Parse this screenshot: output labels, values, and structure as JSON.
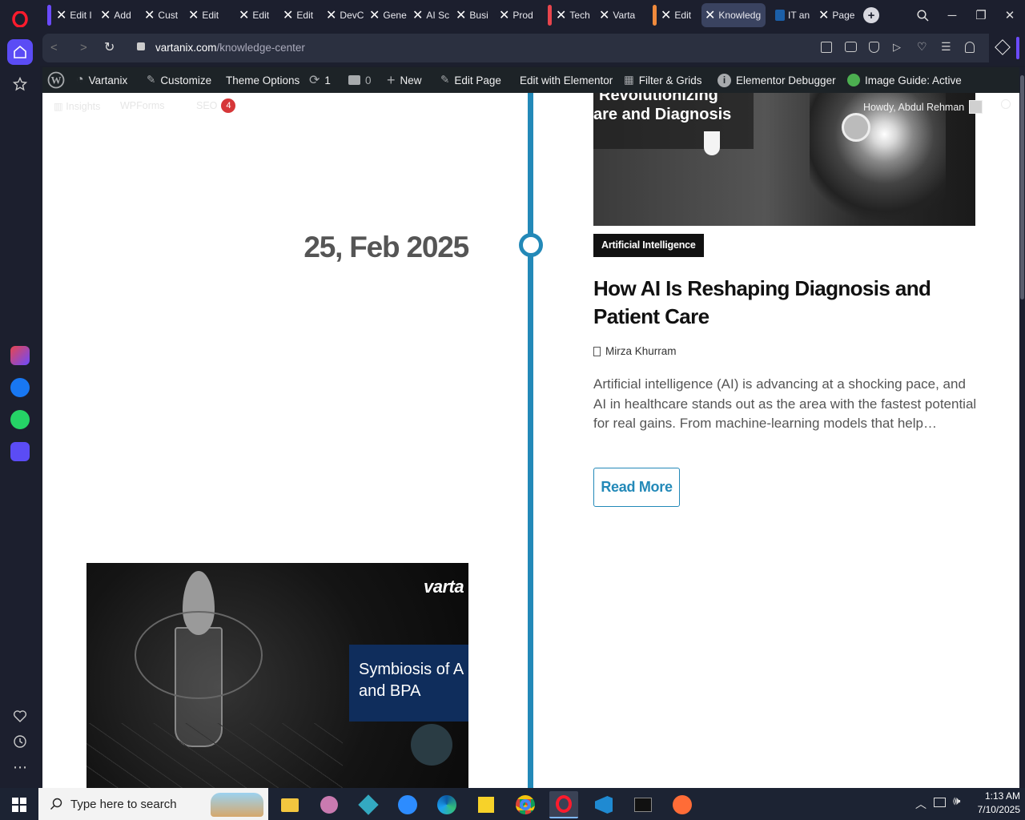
{
  "browser": {
    "tabs": [
      {
        "label": "Edit I"
      },
      {
        "label": "Add"
      },
      {
        "label": "Cust"
      },
      {
        "label": "Edit "
      },
      {
        "label": "Edit "
      },
      {
        "label": "Edit "
      },
      {
        "label": "DevC"
      },
      {
        "label": "Gene"
      },
      {
        "label": "AI Sc"
      },
      {
        "label": "Busi"
      },
      {
        "label": "Prod"
      },
      {
        "label": "Tech"
      },
      {
        "label": "Varta"
      },
      {
        "label": "Edit"
      },
      {
        "label": "Knowledg"
      },
      {
        "label": "IT an"
      },
      {
        "label": "Page"
      }
    ],
    "url": "vartanix.com/knowledge-center",
    "url_domain": "vartanix.com",
    "url_path": "/knowledge-center",
    "accent": "#5b4cf5"
  },
  "wp_admin_bar": {
    "site_name": "Vartanix",
    "customize": "Customize",
    "theme_options": "Theme Options",
    "updates_count": "1",
    "comments_count": "0",
    "new": "New",
    "edit_page": "Edit Page",
    "edit_elementor": "Edit with Elementor",
    "filter_grids": "Filter & Grids",
    "elementor_debugger": "Elementor Debugger",
    "image_guide": "Image Guide: Active",
    "insights": "Insights",
    "wpforms": "WPForms",
    "seo": "SEO",
    "seo_count": "4",
    "howdy": "Howdy, Abdul Rehman"
  },
  "post": {
    "date": "25, Feb 2025",
    "image_text_line1": "Revolutionizing",
    "image_text_line2": "are and Diagnosis",
    "category": "Artificial Intelligence",
    "title": "How AI Is Reshaping Diagnosis and Patient Care",
    "author": "Mirza Khurram",
    "excerpt": "Artificial intelligence (AI) is advancing at a shocking pace, and AI in healthcare stands out as the area with the fastest potential for real gains. From machine-learning models that help…",
    "read_more": "Read More",
    "timeline_color": "#2389b8"
  },
  "next_post": {
    "brand": "varta",
    "banner_line1": "Symbiosis of A",
    "banner_line2": "and BPA"
  },
  "taskbar": {
    "search_placeholder": "Type here to search",
    "time": "1:13 AM",
    "date": "7/10/2025"
  }
}
